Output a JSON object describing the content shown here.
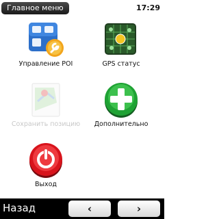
{
  "header": {
    "title": "Главное меню",
    "clock": "17:29"
  },
  "menu": {
    "items": [
      {
        "label": "Управление POI",
        "icon": "poi-management-icon",
        "enabled": true
      },
      {
        "label": "GPS статус",
        "icon": "gps-status-icon",
        "enabled": true
      },
      {
        "label": "Сохранить позицию",
        "icon": "save-position-icon",
        "enabled": false
      },
      {
        "label": "Дополнительно",
        "icon": "plus-icon",
        "enabled": true
      },
      {
        "label": "Выход",
        "icon": "power-icon",
        "enabled": true
      }
    ]
  },
  "footer": {
    "back_label": "Назад",
    "prev_glyph": "‹",
    "next_glyph": "›"
  },
  "colors": {
    "accent_green": "#1fa234",
    "exit_red": "#d8141c",
    "poi_blue": "#2c6fc9",
    "disabled_text": "#c8c8c8"
  }
}
